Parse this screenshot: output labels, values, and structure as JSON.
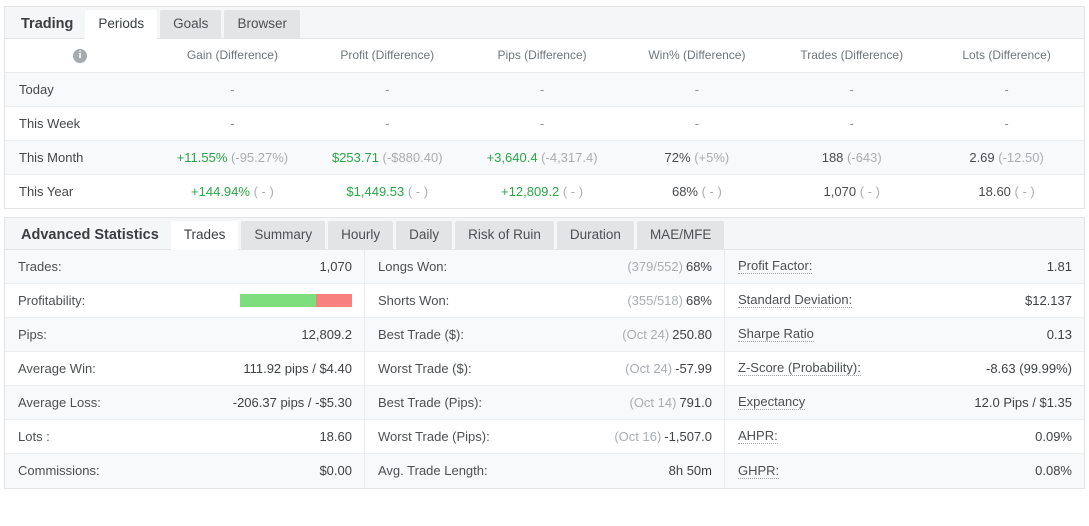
{
  "trading_panel": {
    "title": "Trading",
    "tabs": [
      {
        "label": "Periods",
        "active": true
      },
      {
        "label": "Goals",
        "active": false
      },
      {
        "label": "Browser",
        "active": false
      }
    ],
    "info_icon": "info-icon",
    "info_glyph": "i",
    "columns": [
      "Gain (Difference)",
      "Profit (Difference)",
      "Pips (Difference)",
      "Win% (Difference)",
      "Trades (Difference)",
      "Lots (Difference)"
    ],
    "rows": [
      {
        "label": "Today",
        "cells": [
          {
            "main": "-",
            "diff": "",
            "tone": "dash"
          },
          {
            "main": "-",
            "diff": "",
            "tone": "dash"
          },
          {
            "main": "-",
            "diff": "",
            "tone": "dash"
          },
          {
            "main": "-",
            "diff": "",
            "tone": "dash"
          },
          {
            "main": "-",
            "diff": "",
            "tone": "dash"
          },
          {
            "main": "-",
            "diff": "",
            "tone": "dash"
          }
        ]
      },
      {
        "label": "This Week",
        "cells": [
          {
            "main": "-",
            "diff": "",
            "tone": "dash"
          },
          {
            "main": "-",
            "diff": "",
            "tone": "dash"
          },
          {
            "main": "-",
            "diff": "",
            "tone": "dash"
          },
          {
            "main": "-",
            "diff": "",
            "tone": "dash"
          },
          {
            "main": "-",
            "diff": "",
            "tone": "dash"
          },
          {
            "main": "-",
            "diff": "",
            "tone": "dash"
          }
        ]
      },
      {
        "label": "This Month",
        "cells": [
          {
            "main": "+11.55%",
            "diff": "(-95.27%)",
            "tone": "pos"
          },
          {
            "main": "$253.71",
            "diff": "(-$880.40)",
            "tone": "pos"
          },
          {
            "main": "+3,640.4",
            "diff": "(-4,317.4)",
            "tone": "pos"
          },
          {
            "main": "72%",
            "diff": "(+5%)",
            "tone": "neu"
          },
          {
            "main": "188",
            "diff": "(-643)",
            "tone": "neu"
          },
          {
            "main": "2.69",
            "diff": "(-12.50)",
            "tone": "neu"
          }
        ]
      },
      {
        "label": "This Year",
        "cells": [
          {
            "main": "+144.94%",
            "diff": "( - )",
            "tone": "pos"
          },
          {
            "main": "$1,449.53",
            "diff": "( - )",
            "tone": "pos"
          },
          {
            "main": "+12,809.2",
            "diff": "( - )",
            "tone": "pos"
          },
          {
            "main": "68%",
            "diff": "( - )",
            "tone": "neu"
          },
          {
            "main": "1,070",
            "diff": "( - )",
            "tone": "neu"
          },
          {
            "main": "18.60",
            "diff": "( - )",
            "tone": "neu"
          }
        ]
      }
    ]
  },
  "stats_panel": {
    "title": "Advanced Statistics",
    "tabs": [
      {
        "label": "Trades",
        "active": true
      },
      {
        "label": "Summary",
        "active": false
      },
      {
        "label": "Hourly",
        "active": false
      },
      {
        "label": "Daily",
        "active": false
      },
      {
        "label": "Risk of Ruin",
        "active": false
      },
      {
        "label": "Duration",
        "active": false
      },
      {
        "label": "MAE/MFE",
        "active": false
      }
    ],
    "profitability_bar": {
      "win_percent": 68,
      "loss_percent": 32,
      "win_color": "#7ede7e",
      "loss_color": "#f8807f"
    },
    "col1": [
      {
        "label": "Trades:",
        "pre": "",
        "value": "1,070",
        "hint": false,
        "bar": false
      },
      {
        "label": "Profitability:",
        "pre": "",
        "value": "",
        "hint": false,
        "bar": true
      },
      {
        "label": "Pips:",
        "pre": "",
        "value": "12,809.2",
        "hint": false,
        "bar": false
      },
      {
        "label": "Average Win:",
        "pre": "",
        "value": "111.92 pips / $4.40",
        "hint": false,
        "bar": false
      },
      {
        "label": "Average Loss:",
        "pre": "",
        "value": "-206.37 pips / -$5.30",
        "hint": false,
        "bar": false
      },
      {
        "label": "Lots :",
        "pre": "",
        "value": "18.60",
        "hint": false,
        "bar": false
      },
      {
        "label": "Commissions:",
        "pre": "",
        "value": "$0.00",
        "hint": false,
        "bar": false
      }
    ],
    "col2": [
      {
        "label": "Longs Won:",
        "pre": "(379/552)",
        "value": "68%",
        "hint": false,
        "bar": false
      },
      {
        "label": "Shorts Won:",
        "pre": "(355/518)",
        "value": "68%",
        "hint": false,
        "bar": false
      },
      {
        "label": "Best Trade ($):",
        "pre": "(Oct 24)",
        "value": "250.80",
        "hint": false,
        "bar": false
      },
      {
        "label": "Worst Trade ($):",
        "pre": "(Oct 24)",
        "value": "-57.99",
        "hint": false,
        "bar": false
      },
      {
        "label": "Best Trade (Pips):",
        "pre": "(Oct 14)",
        "value": "791.0",
        "hint": false,
        "bar": false
      },
      {
        "label": "Worst Trade (Pips):",
        "pre": "(Oct 16)",
        "value": "-1,507.0",
        "hint": false,
        "bar": false
      },
      {
        "label": "Avg. Trade Length:",
        "pre": "",
        "value": "8h 50m",
        "hint": false,
        "bar": false
      }
    ],
    "col3": [
      {
        "label": "Profit Factor:",
        "pre": "",
        "value": "1.81",
        "hint": true,
        "bar": false
      },
      {
        "label": "Standard Deviation:",
        "pre": "",
        "value": "$12.137",
        "hint": true,
        "bar": false
      },
      {
        "label": "Sharpe Ratio",
        "pre": "",
        "value": "0.13",
        "hint": true,
        "bar": false
      },
      {
        "label": "Z-Score (Probability):",
        "pre": "",
        "value": "-8.63 (99.99%)",
        "hint": true,
        "bar": false
      },
      {
        "label": "Expectancy",
        "pre": "",
        "value": "12.0 Pips / $1.35",
        "hint": true,
        "bar": false
      },
      {
        "label": "AHPR:",
        "pre": "",
        "value": "0.09%",
        "hint": true,
        "bar": false
      },
      {
        "label": "GHPR:",
        "pre": "",
        "value": "0.08%",
        "hint": true,
        "bar": false
      }
    ]
  },
  "colors": {
    "positive": "#28a846",
    "neutral": "#494c4f",
    "dim": "#a9aeb2",
    "panel_border": "#e2e4e6",
    "tab_inactive_bg": "#e3e4e5",
    "tabbar_bg": "#f5f6f7",
    "row_odd_bg": "#f8f9fb"
  }
}
